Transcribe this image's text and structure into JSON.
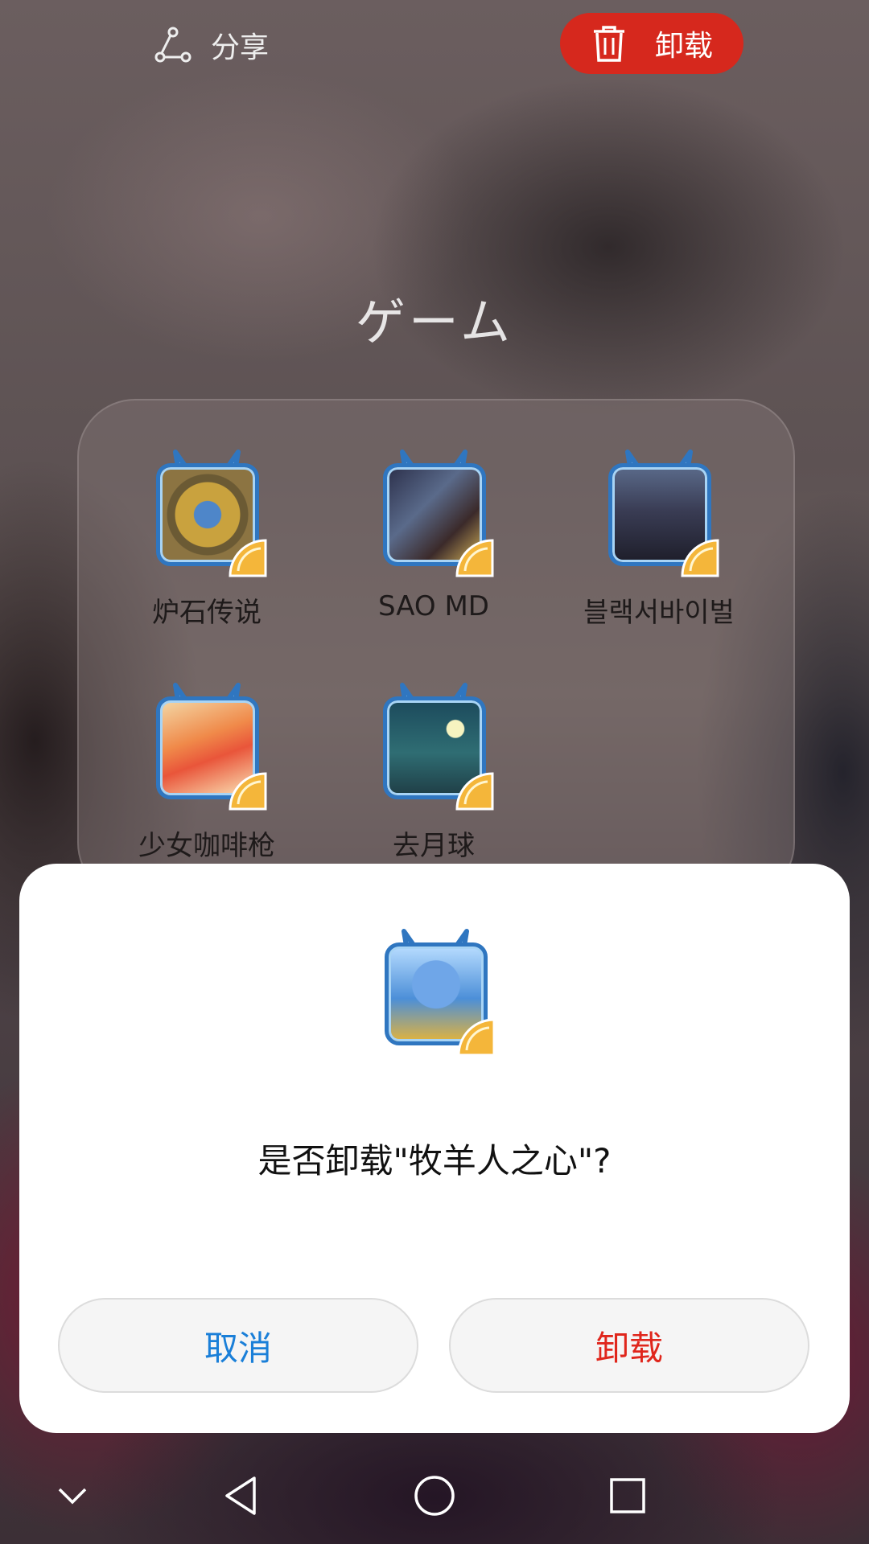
{
  "top_bar": {
    "share_label": "分享",
    "uninstall_label": "卸载",
    "uninstall_color": "#d6281d"
  },
  "folder": {
    "title": "ゲーム",
    "apps": [
      {
        "label": "炉石传说",
        "icon": "hearthstone-icon"
      },
      {
        "label": "SAO MD",
        "icon": "sao-md-icon"
      },
      {
        "label": "블랙서바이벌",
        "icon": "black-survival-icon"
      },
      {
        "label": "少女咖啡枪",
        "icon": "girl-cafe-gun-icon"
      },
      {
        "label": "去月球",
        "icon": "to-the-moon-icon"
      }
    ]
  },
  "dialog": {
    "app_icon": "shepherd-heart-icon",
    "message": "是否卸载\"牧羊人之心\"?",
    "cancel_label": "取消",
    "confirm_label": "卸载",
    "cancel_color": "#1a7fd8",
    "confirm_color": "#e0261c"
  },
  "nav_bar": {
    "items": [
      "chevron-down-icon",
      "back-icon",
      "home-icon",
      "recents-icon"
    ]
  }
}
